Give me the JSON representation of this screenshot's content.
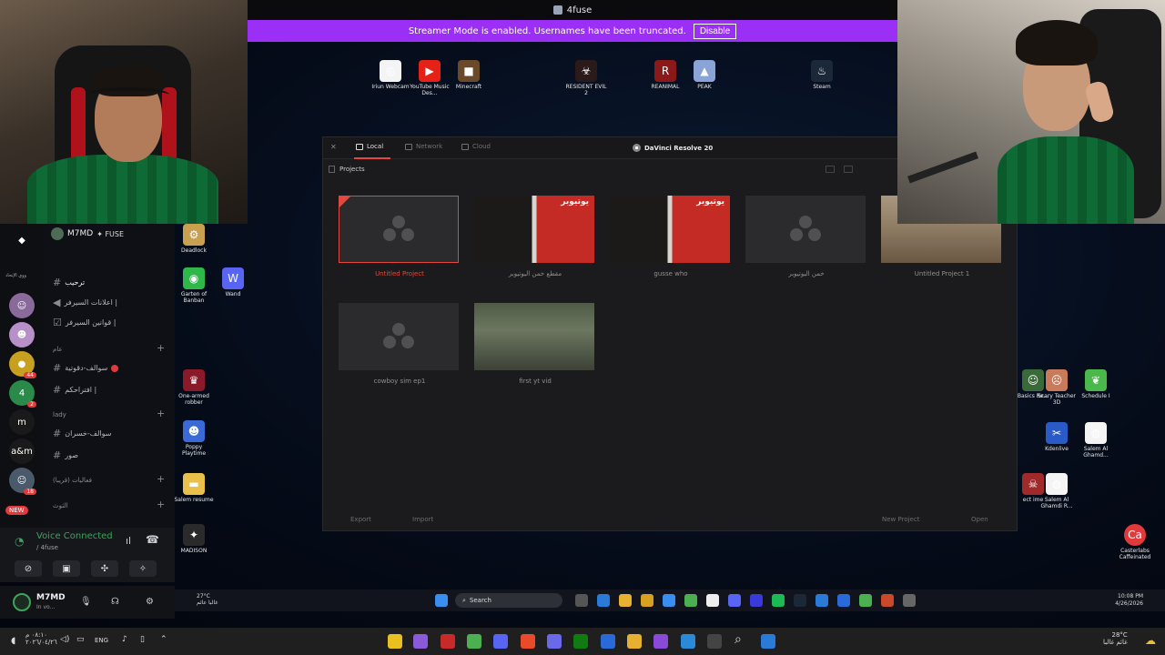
{
  "window_title": "4fuse",
  "banner": {
    "message": "Streamer Mode is enabled. Usernames have been truncated.",
    "button": "Disable"
  },
  "desktop_icons_top": [
    {
      "label": "Iriun Webcam",
      "color": "#f4f4f4",
      "glyph": "◎"
    },
    {
      "label": "YouTube Music Des...",
      "color": "#e62117",
      "glyph": "▶"
    },
    {
      "label": "Minecraft",
      "color": "#6a4a2a",
      "glyph": "■"
    },
    {
      "label": "RESIDENT EVIL 2",
      "color": "#2a1a1a",
      "glyph": "☣"
    },
    {
      "label": "REANIMAL",
      "color": "#8a1a1a",
      "glyph": "R"
    },
    {
      "label": "PEAK",
      "color": "#8aa4d8",
      "glyph": "▲"
    },
    {
      "label": "Steam",
      "color": "#1b2838",
      "glyph": "♨"
    }
  ],
  "desktop_icons_left": [
    {
      "label": "Deadlock",
      "color": "#c8a050",
      "glyph": "⚙"
    },
    {
      "label": "Garten of Banban",
      "color": "#2fb84a",
      "glyph": "◉"
    },
    {
      "label": "Wand",
      "color": "#5865f2",
      "glyph": "W"
    },
    {
      "label": "One-armed robber",
      "color": "#8a1a2a",
      "glyph": "♛"
    },
    {
      "label": "Poppy Playtime",
      "color": "#3a6ad8",
      "glyph": "☻"
    },
    {
      "label": "Salem resume",
      "color": "#e8c04a",
      "glyph": "▬"
    },
    {
      "label": "MADISON",
      "color": "#2a2a2a",
      "glyph": "✦"
    }
  ],
  "desktop_icons_right": [
    {
      "label": "Basics Re...",
      "color": "#3a6a3a",
      "glyph": "☺"
    },
    {
      "label": "Scary Teacher 3D",
      "color": "#c87a5a",
      "glyph": "☹"
    },
    {
      "label": "Schedule I",
      "color": "#4ab84a",
      "glyph": "❦"
    },
    {
      "label": "Kdenlive",
      "color": "#2a5ac8",
      "glyph": "✂"
    },
    {
      "label": "Salem Al Ghamd...",
      "color": "#f4f4f4",
      "glyph": "◍"
    },
    {
      "label": "ect ime",
      "color": "#a02a2a",
      "glyph": "☠"
    },
    {
      "label": "Salem Al Ghamdi R...",
      "color": "#f4f4f4",
      "glyph": "◍"
    },
    {
      "label": "Casterlabs Caffeinated",
      "color": "#e23a3a",
      "glyph": "Ca"
    }
  ],
  "resolve": {
    "title": "DaVinci Resolve 20",
    "tabs": [
      "Local",
      "Network",
      "Cloud"
    ],
    "section": "Projects",
    "projects": [
      {
        "name": "Untitled Project",
        "thumb": "logo",
        "selected": true
      },
      {
        "name": "مقطع خمن اليوتيوبر",
        "thumb": "cam",
        "selected": false
      },
      {
        "name": "gusse who",
        "thumb": "cam",
        "selected": false
      },
      {
        "name": "خمن اليوتيوبر",
        "thumb": "logo",
        "selected": false
      },
      {
        "name": "Untitled Project 1",
        "thumb": "desert",
        "selected": false
      },
      {
        "name": "cowboy sim ep1",
        "thumb": "logo",
        "selected": false
      },
      {
        "name": "first yt vid",
        "thumb": "game",
        "selected": false
      }
    ],
    "buttons": {
      "export": "Export",
      "import": "Import",
      "new_project": "New Project",
      "open": "Open"
    },
    "thumb_overlay_text": "يوتيوبر"
  },
  "discord": {
    "server_name": "M7MD",
    "server_tag": "FUSE",
    "servers": [
      {
        "glyph": "◆",
        "color": "#0e0f12",
        "badge": ""
      },
      {
        "glyph": "☺",
        "color": "#8a6a9a",
        "badge": ""
      },
      {
        "glyph": "☻",
        "color": "#b890c8",
        "badge": ""
      },
      {
        "glyph": "●",
        "color": "#c8a020",
        "badge": "44"
      },
      {
        "glyph": "4",
        "color": "#2a8a4a",
        "badge": "2"
      },
      {
        "glyph": "m",
        "color": "#1a1a1a",
        "badge": ""
      },
      {
        "glyph": "a&m",
        "color": "#1a1a1a",
        "badge": ""
      },
      {
        "glyph": "☺",
        "color": "#4a5a6a",
        "badge": "18"
      }
    ],
    "server_list_label": "ووي الإتحاد",
    "new_label": "NEW",
    "channels": [
      {
        "type": "channel",
        "name": "ترحيب",
        "icon": "#",
        "active": true
      },
      {
        "type": "channel",
        "name": "اعلانات السيرفر |",
        "icon": "◀",
        "active": false
      },
      {
        "type": "channel",
        "name": "قوانين السيرفر |",
        "icon": "☑",
        "active": false
      },
      {
        "type": "category",
        "name": "عام"
      },
      {
        "type": "channel",
        "name": "سوالف-دقوتية",
        "icon": "#",
        "active": false
      },
      {
        "type": "channel",
        "name": "افتراحكم |",
        "icon": "#",
        "active": false
      },
      {
        "type": "category",
        "name": "lady"
      },
      {
        "type": "channel",
        "name": "سوالف-خسران",
        "icon": "#",
        "active": false
      },
      {
        "type": "channel",
        "name": "صور",
        "icon": "#",
        "active": false
      },
      {
        "type": "category",
        "name": "فعاليات (قريبا)"
      },
      {
        "type": "category",
        "name": "الثوث"
      }
    ],
    "voice": {
      "status": "Voice Connected",
      "channel": "/ 4fuse"
    },
    "user": {
      "name": "M7MD",
      "status": "In vo..."
    }
  },
  "inner_taskbar": {
    "weather_temp": "27°C",
    "weather_desc": "غالبا عائم",
    "search": "Search",
    "time": "10:08 PM",
    "date": "4/26/2026"
  },
  "outer_taskbar": {
    "time": "٠٨:١٠ م",
    "date": "٢٠٢٦/٠٤/٢٦",
    "lang": "ENG",
    "weather_temp": "28°C",
    "weather_desc": "غائم غالبا"
  }
}
